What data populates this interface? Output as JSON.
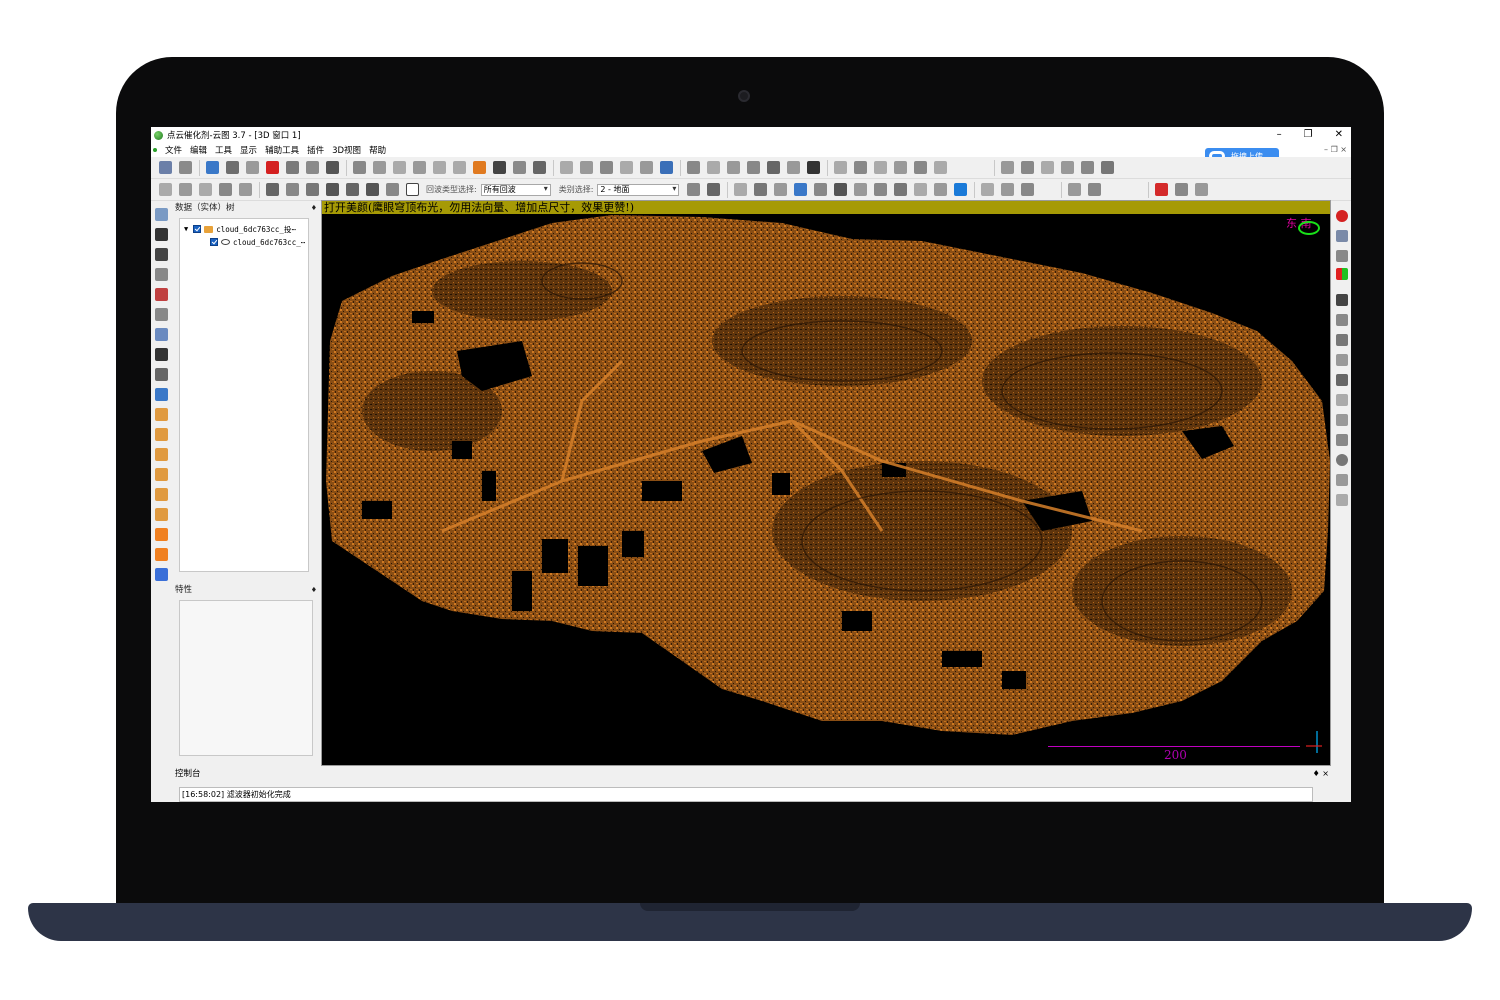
{
  "window": {
    "title": "点云催化剂-云图 3.7 - [3D 窗口 1]",
    "controls": [
      "–",
      "❐",
      "✕"
    ]
  },
  "menu": {
    "items": [
      "文件",
      "编辑",
      "工具",
      "显示",
      "辅助工具",
      "插件",
      "3D视图",
      "帮助"
    ],
    "right_mark": "– ❐ ×"
  },
  "upload": {
    "label": "拖拽上传",
    "icon": "cloud-upload-icon",
    "color": "#3b8df0"
  },
  "toolbar2": {
    "echo_type_label": "回波类型选择:",
    "echo_type_value": "所有回波",
    "class_label": "类别选择:",
    "class_value": "2 - 地面"
  },
  "dbtree": {
    "header": "数据（实体）树",
    "pin": "♦",
    "items": [
      {
        "label": "cloud_6dc763cc_投⋯",
        "icon": "folder-icon",
        "checked": true
      },
      {
        "label": "cloud_6dc763cc_⋯",
        "icon": "point-cloud-icon",
        "checked": true
      }
    ]
  },
  "properties": {
    "header": "特性",
    "pin": "♦"
  },
  "viewport": {
    "banner": "打开美颜(鹰眼穹顶布光，勿用法向量、增加点尺寸，效果更赞!)",
    "compass_label": "东  南",
    "scale_value": "200",
    "point_color": "#c0701e",
    "background": "#000000"
  },
  "console": {
    "header": "控制台",
    "controls": "♦ ×",
    "log": "[16:58:02] 滤波器初始化完成"
  }
}
